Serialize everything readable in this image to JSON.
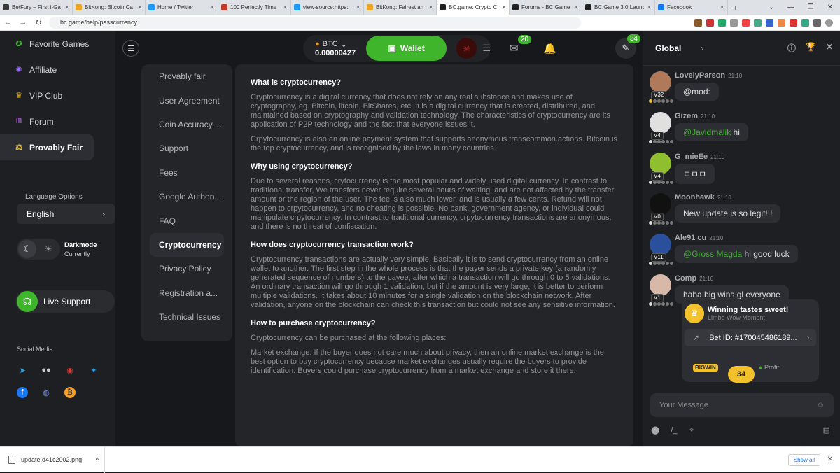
{
  "browser": {
    "tabs": [
      {
        "title": "BetFury – First i-Ga",
        "color": "#3a3a3a"
      },
      {
        "title": "BitKong: Bitcoin Ca",
        "color": "#e8a623"
      },
      {
        "title": "Home / Twitter",
        "color": "#1d9bf0"
      },
      {
        "title": "100 Perfectly Time",
        "color": "#c0392b"
      },
      {
        "title": "view-source:https:",
        "color": "#1d9bf0"
      },
      {
        "title": "BitKong: Fairest an",
        "color": "#e8a623"
      },
      {
        "title": "BC.game: Crypto C",
        "color": "#222222"
      },
      {
        "title": "Forums - BC.Game",
        "color": "#222222"
      },
      {
        "title": "BC.Game 3.0 Launc",
        "color": "#222222"
      },
      {
        "title": "Facebook",
        "color": "#1877f2"
      }
    ],
    "url": "bc.game/help/passcurrency"
  },
  "leftnav": {
    "items": [
      {
        "label": "Favorite Games",
        "icon": "star-icon"
      },
      {
        "label": "Affiliate",
        "icon": "affiliate-icon"
      },
      {
        "label": "VIP Club",
        "icon": "crown-icon"
      },
      {
        "label": "Forum",
        "icon": "forum-icon"
      },
      {
        "label": "Provably Fair",
        "icon": "scale-icon"
      }
    ],
    "language_label": "Language Options",
    "language_value": "English",
    "darkmode_title": "Darkmode",
    "darkmode_sub": "Currently",
    "support_label": "Live Support",
    "social_label": "Social Media"
  },
  "header": {
    "currency": "BTC",
    "balance": "0.00000427",
    "wallet_label": "Wallet",
    "mail_count": "20",
    "chat_count": "34"
  },
  "help_menu": [
    "Provably fair",
    "User Agreement",
    "Coin Accuracy ...",
    "Support",
    "Fees",
    "Google Authen...",
    "FAQ",
    "Cryptocurrency",
    "Privacy Policy",
    "Registration a...",
    "Technical Issues"
  ],
  "article": {
    "h1": "What is cryptocurrency?",
    "p1": "Cryptocurrency is a digital currency that does not rely on any real substance and makes use of cryptography, eg. Bitcoin, litcoin, BitShares, etc. It is a digital currency that is created, distributed, and maintained based on cryptography and validation technology. The characteristics of cryptocurrency are its application of P2P technology and the fact that everyone issues it.",
    "p2": "Crpytocurrency is also an online payment system that supports anonymous transcommon.actions. Bitcoin is the top cryptocurrency, and is recognised by the laws in many countries.",
    "h2": "Why using crpytocurrency?",
    "p3": "Due to several reasons, crytocurrency is the most popular and widely used digital currency. In contrast to traditional transfer, We transfers never require several hours of waiting, and are not affected by the transfer amount or the region of the user. The fee is also much lower, and is usually a few cents. Refund will not happen to crpytocurrency, and no cheating is possible. No bank, government agency, or individual could manipulate crpytocurrency. In contrast to traditional currency, crpytocurrency transactions are anonymous, and there is no threat of confiscation.",
    "h3": "How does cryptocurrency transaction work?",
    "p4": "Cryptocurrency transactions are actually very simple. Basically it is to send cryptocurrency from an online wallet to another. The first step in the whole process is that the payer sends a private key (a randomly generated sequence of numbers) to the payee, after which a transaction will go through 0 to 5 validations. An ordinary transaction will go through 1 validation, but if the amount is very large, it is better to perform multiple validations. It takes about 10 minutes for a single validation on the blockchain network. After validation, anyone on the blockchain can check this transaction but could not see any sensitive information.",
    "h4": "How to purchase cryptocurrency?",
    "p5": "Cryptocurrency can be purchased at the following places:",
    "p6": "Market exchange: If the buyer does not care much about privacy, then an online market exchange is the best option to buy cryptocurrency because market exchanges usually require the buyers to provide identification. Buyers could purchase cryptocurrency from a market exchange and store it there."
  },
  "chat": {
    "tab": "Global",
    "messages": [
      {
        "user": "LovelyParson",
        "time": "21:10",
        "vip": "V32",
        "mention": "",
        "text": "@mod:",
        "avatar": "#b07a5a"
      },
      {
        "user": "Gizem",
        "time": "21:10",
        "vip": "V4",
        "mention": "@Javidmalik",
        "text": " hi",
        "avatar": "#e0e0e0"
      },
      {
        "user": "G_mieEe",
        "time": "21:10",
        "vip": "V4",
        "mention": "",
        "text": "ㅁㅁㅁ",
        "avatar": "#8fbf2f"
      },
      {
        "user": "Moonhawk",
        "time": "21:10",
        "vip": "V0",
        "mention": "",
        "text": "New update is so legit!!!",
        "avatar": "#111111"
      },
      {
        "user": "Ale91 cu",
        "time": "21:10",
        "vip": "V11",
        "mention": "@Gross Magda",
        "text": " hi good luck",
        "avatar": "#2a4f9c"
      },
      {
        "user": "Comp",
        "time": "21:10",
        "vip": "V1",
        "mention": "",
        "text": "haha big wins gl everyone",
        "avatar": "#d8b8a8"
      }
    ],
    "win_card": {
      "title": "Winning tastes sweet!",
      "subtitle": "Limbo Wow Moment",
      "bet_id": "Bet ID: #170045486189...",
      "badge": "BIGWIN",
      "profit": "Profit",
      "count": "34"
    },
    "input_placeholder": "Your Message"
  },
  "downloads": {
    "file": "update.d41c2002.png",
    "show_all": "Show all"
  }
}
